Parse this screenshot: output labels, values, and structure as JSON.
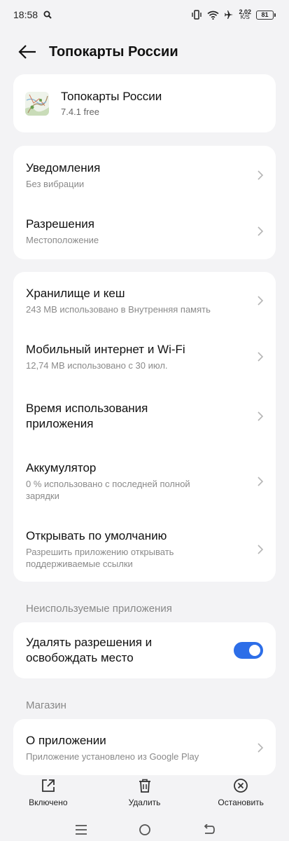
{
  "status_bar": {
    "time": "18:58",
    "speed_value": "2,02",
    "speed_unit": "K/S",
    "battery": "81"
  },
  "header": {
    "title": "Топокарты России"
  },
  "app": {
    "name": "Топокарты России",
    "version": "7.4.1 free"
  },
  "group1": [
    {
      "title": "Уведомления",
      "sub": "Без вибрации"
    },
    {
      "title": "Разрешения",
      "sub": "Местоположение"
    }
  ],
  "group2": [
    {
      "title": "Хранилище и кеш",
      "sub": "243 MB использовано в Внутренняя память"
    },
    {
      "title": "Мобильный интернет и Wi-Fi",
      "sub": "12,74 MB использовано с 30 июл."
    },
    {
      "title": "Время использования приложения",
      "sub": ""
    },
    {
      "title": "Аккумулятор",
      "sub": "0 % использовано с последней полной зарядки"
    },
    {
      "title": "Открывать по умолчанию",
      "sub": "Разрешить приложению открывать поддерживаемые ссылки"
    }
  ],
  "unused": {
    "label": "Неиспользуемые приложения",
    "toggle_title": "Удалять разрешения и освобождать место",
    "toggle_on": true
  },
  "store": {
    "label": "Магазин",
    "title": "О приложении",
    "sub": "Приложение установлено из Google Play"
  },
  "actions": {
    "open": "Включено",
    "uninstall": "Удалить",
    "stop": "Остановить"
  },
  "colors": {
    "accent": "#2d6ee8",
    "background": "#f3f3f5",
    "card": "#ffffff"
  }
}
